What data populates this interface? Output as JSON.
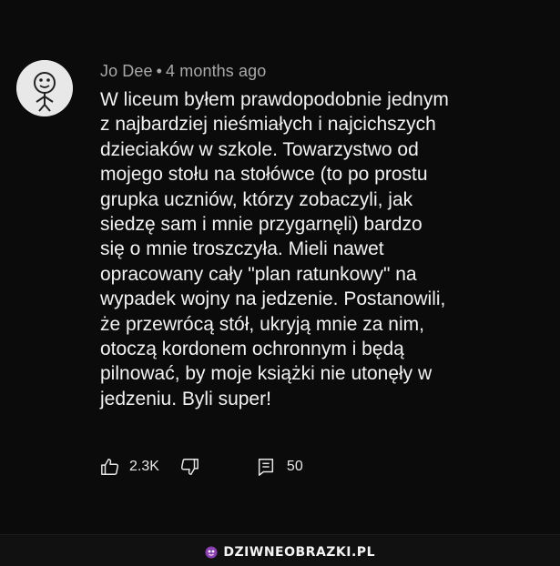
{
  "comment": {
    "author": "Jo Dee",
    "separator": "•",
    "timestamp": "4 months ago",
    "text_lines": [
      "W liceum byłem prawdopodobnie jednym",
      "z najbardziej nieśmiałych i najcichszych",
      "dzieciaków w szkole. Towarzystwo od",
      "mojego stołu na stołówce (to po prostu",
      "grupka uczniów, którzy zobaczyli, jak",
      "siedzę sam i mnie przygarnęli) bardzo",
      "się o mnie troszczyła. Mieli nawet",
      "opracowany cały \"plan ratunkowy\" na",
      "wypadek wojny na jedzenie. Postanowili,",
      "że przewrócą stół, ukryją mnie za nim,",
      "otoczą kordonem ochronnym i będą",
      "pilnować, by moje książki nie utonęły w",
      "jedzeniu. Byli super!"
    ]
  },
  "actions": {
    "like_count": "2.3K",
    "reply_count": "50"
  },
  "watermark": {
    "text": "DZIWNEOBRAZKI.PL",
    "accent_color": "#8b3fb3"
  },
  "icons": {
    "avatar": "avatar-icon",
    "like": "thumbs-up-icon",
    "dislike": "thumbs-down-icon",
    "reply": "reply-icon",
    "brand": "brand-icon"
  }
}
